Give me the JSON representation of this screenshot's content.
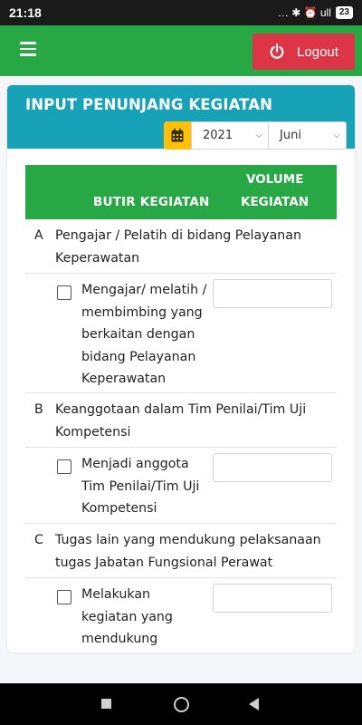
{
  "status_bar": {
    "time": "21:18",
    "indicators": "… ✱ ⏰ ull",
    "battery": "23"
  },
  "app_bar": {
    "menu_icon": "hamburger-icon",
    "logout_label": "Logout",
    "logout_icon": "power-icon",
    "colors": {
      "appbar": "#28a745",
      "logout": "#dc3545"
    }
  },
  "card": {
    "title": "INPUT PENUNJANG KEGIATAN",
    "header_color": "#17a2b8",
    "year_value": "2021",
    "month_value": "Juni",
    "calendar_icon": "calendar-icon"
  },
  "table": {
    "col_butir": "BUTIR KEGIATAN",
    "col_volume_1": "VOLUME",
    "col_volume_2": "KEGIATAN",
    "header_color": "#28a745"
  },
  "sections": [
    {
      "letter": "A",
      "title": "Pengajar / Pelatih di bidang Pelayanan Keperawatan",
      "item": "Mengajar/ melatih / membimbing yang berkaitan dengan bidang Pelayanan Keperawatan",
      "volume": ""
    },
    {
      "letter": "B",
      "title": "Keanggotaan dalam Tim Penilai/Tim Uji Kompetensi",
      "item": "Menjadi anggota Tim Penilai/Tim Uji Kompetensi",
      "volume": ""
    },
    {
      "letter": "C",
      "title": "Tugas lain yang mendukung pelaksanaan tugas Jabatan Fungsional Perawat",
      "item": "Melakukan kegiatan yang mendukung",
      "volume": ""
    }
  ],
  "nav_bar": {
    "recents_icon": "square-icon",
    "home_icon": "circle-icon",
    "back_icon": "back-triangle-icon"
  }
}
